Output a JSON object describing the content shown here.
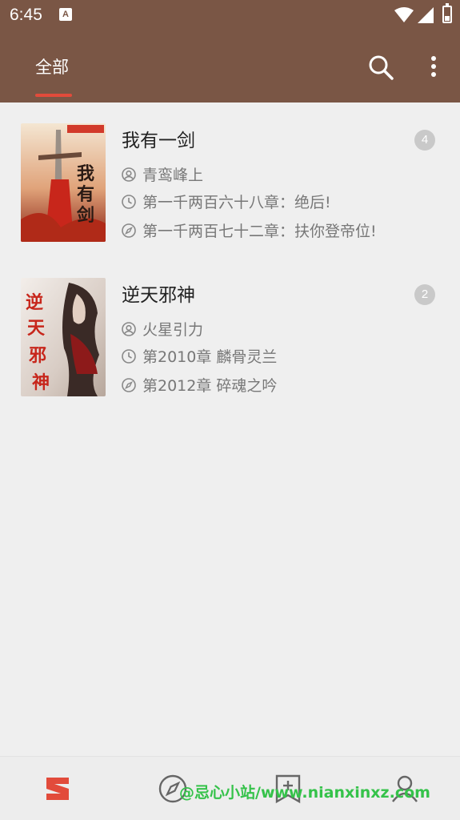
{
  "status_bar": {
    "time": "6:45",
    "indicator": "A"
  },
  "app_bar": {
    "tab_label": "全部",
    "accent_color": "#e24b3b",
    "bar_color": "#7a5645"
  },
  "books": [
    {
      "title": "我有一剑",
      "author": "青鸾峰上",
      "last_read": "第一千两百六十八章：绝后!",
      "latest": "第一千两百七十二章：扶你登帝位!",
      "unread": "4",
      "cover_text": "我有一剑"
    },
    {
      "title": "逆天邪神",
      "author": "火星引力",
      "last_read": "第2010章 麟骨灵兰",
      "latest": "第2012章 碎魂之吟",
      "unread": "2",
      "cover_text": "逆天邪神"
    }
  ],
  "bottom_nav": {
    "items": [
      "bookshelf-icon",
      "compass-icon",
      "bookmark-add-icon",
      "person-icon"
    ]
  },
  "watermark": "@忌心小站/www.nianxinxz.com"
}
